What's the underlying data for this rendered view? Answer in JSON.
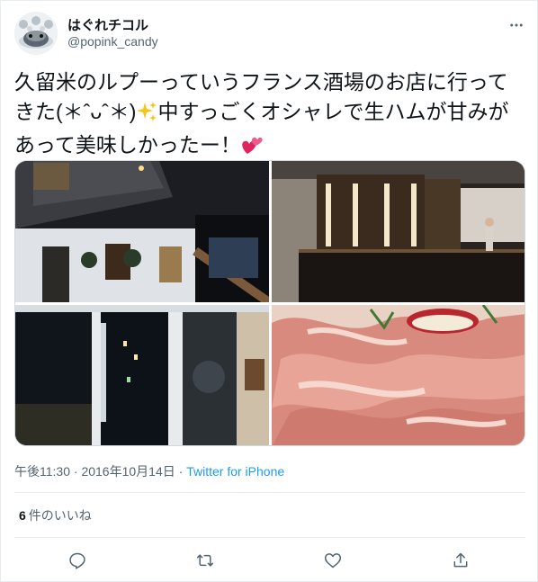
{
  "user": {
    "display_name": "はぐれチコル",
    "handle": "@popink_candy"
  },
  "tweet": {
    "text_before_sparkle": "久留米のルプーっていうフランス酒場のお店に行ってきた(＊ˆᴗˆ＊)",
    "sparkle_icon": "sparkles-icon",
    "text_after_sparkle": "中すっごくオシャレで生ハムが甘みがあって美味しかったー！",
    "heart_icon": "two-hearts-icon"
  },
  "media": [
    {
      "icon": "photo-restaurant-exterior"
    },
    {
      "icon": "photo-bar-counter"
    },
    {
      "icon": "photo-window-night"
    },
    {
      "icon": "photo-prosciutto-plate"
    }
  ],
  "meta": {
    "time": "午後11:30",
    "separator": " · ",
    "date": "2016年10月14日",
    "separator2": " · ",
    "source": "Twitter for iPhone"
  },
  "likes": {
    "count": "6",
    "label": "件のいいね"
  },
  "actions": {
    "reply_icon": "reply-icon",
    "retweet_icon": "retweet-icon",
    "like_icon": "like-icon",
    "share_icon": "share-icon"
  },
  "colors": {
    "text": "#0f1419",
    "secondary": "#536471",
    "link": "#1d9bf0",
    "border": "#e6ecf0"
  }
}
